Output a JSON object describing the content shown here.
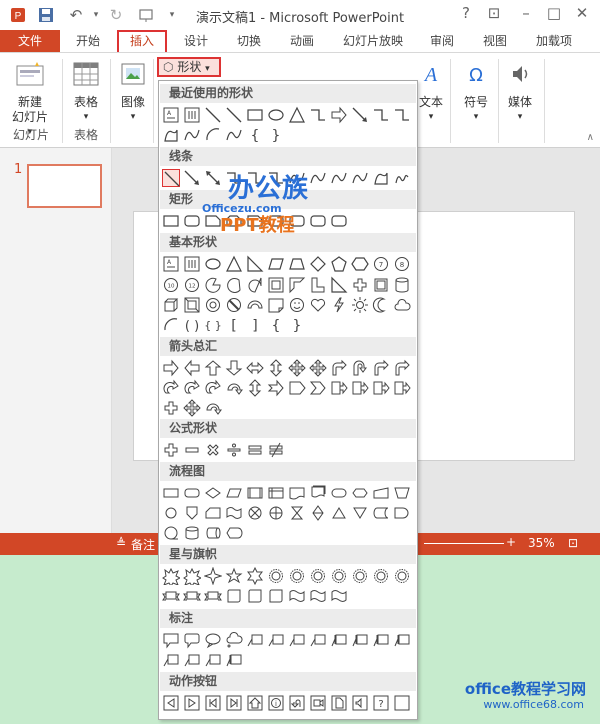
{
  "window": {
    "title": "演示文稿1 - Microsoft PowerPoint"
  },
  "tabs": [
    {
      "id": "file",
      "label": "文件"
    },
    {
      "id": "home",
      "label": "开始"
    },
    {
      "id": "insert",
      "label": "插入"
    },
    {
      "id": "design",
      "label": "设计"
    },
    {
      "id": "transitions",
      "label": "切换"
    },
    {
      "id": "animations",
      "label": "动画"
    },
    {
      "id": "slideshow",
      "label": "幻灯片放映"
    },
    {
      "id": "review",
      "label": "审阅"
    },
    {
      "id": "view",
      "label": "视图"
    },
    {
      "id": "addins",
      "label": "加载项"
    }
  ],
  "ribbon": {
    "new_slide": "新建\n幻灯片",
    "table": "表格",
    "image": "图像",
    "shapes_button": "形状",
    "text": "文本",
    "symbol": "符号",
    "media": "媒体",
    "group_slides": "幻灯片",
    "group_tables": "表格"
  },
  "slides": {
    "current_number": "1"
  },
  "statusbar": {
    "notes_label": "备注",
    "zoom": "35%"
  },
  "shapes_panel": {
    "sections": [
      "最近使用的形状",
      "线条",
      "矩形",
      "基本形状",
      "箭头总汇",
      "公式形状",
      "流程图",
      "星与旗帜",
      "标注",
      "动作按钮"
    ]
  },
  "watermarks": {
    "logo_main": "办公族",
    "logo_url": "Officezu.com",
    "logo_sub": "PPT教程",
    "site_name": "office教程学习网",
    "site_url": "www.office68.com"
  },
  "colors": {
    "accent": "#d24726",
    "highlight_border": "#dd3333",
    "watermark_blue": "#2a6fd6",
    "watermark_orange": "#e8731e"
  }
}
